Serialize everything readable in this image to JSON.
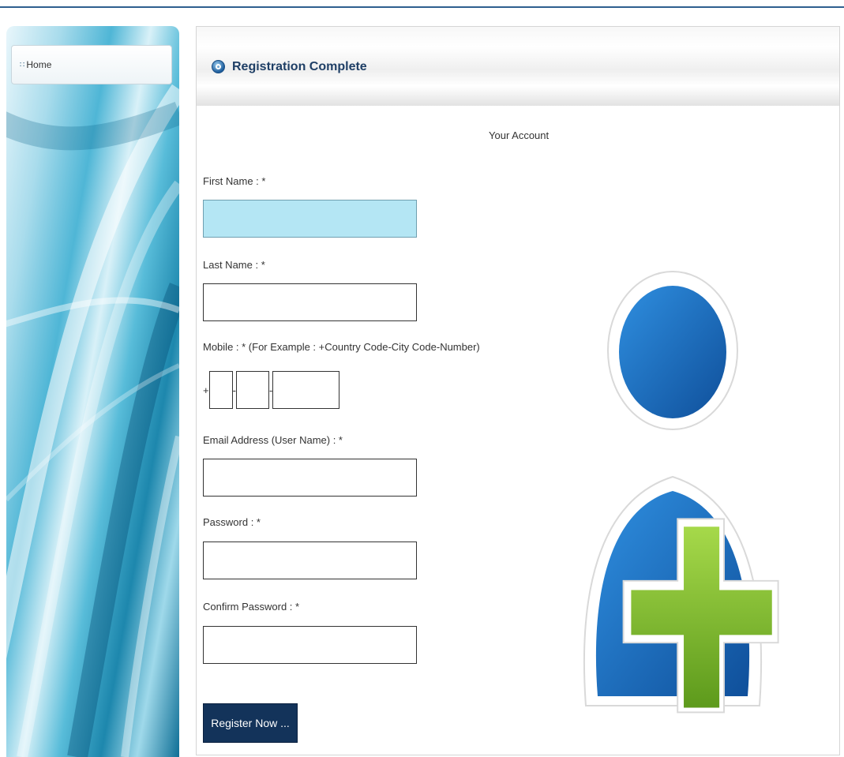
{
  "sidebar": {
    "home_label": "Home"
  },
  "header": {
    "title": "Registration Complete"
  },
  "form": {
    "subheading": "Your Account",
    "first_name_label": "First Name : *",
    "first_name_value": "",
    "last_name_label": "Last Name : *",
    "last_name_value": "",
    "mobile_label": "Mobile : * (For Example : +Country Code-City Code-Number)",
    "mobile_prefix": "+",
    "mobile_separator": "-",
    "country_code_value": "",
    "city_code_value": "",
    "number_value": "",
    "email_label": "Email Address (User Name) : *",
    "email_value": "",
    "password_label": "Password : *",
    "password_value": "",
    "confirm_password_label": "Confirm Password : *",
    "confirm_password_value": "",
    "register_button_label": "Register Now ..."
  },
  "colors": {
    "header_title": "#1f3f66",
    "active_field": "#b4e6f4",
    "register_button": "#13335a",
    "user_icon_blue": "#1a6fc0",
    "plus_icon_green": "#7fbf2a"
  },
  "icons": {
    "header": "registration-info-icon",
    "illustration": "add-user-icon"
  }
}
